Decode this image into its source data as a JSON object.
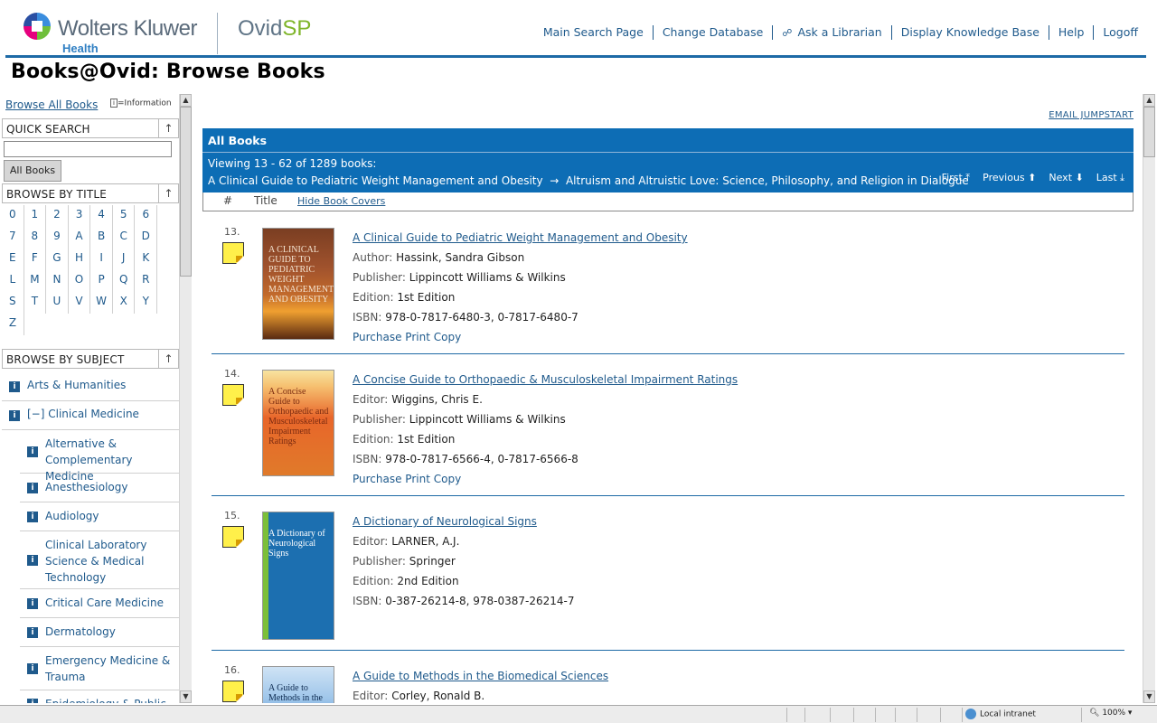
{
  "header": {
    "brand": "Wolters Kluwer",
    "brand_sub": "Health",
    "product_main": "Ovid",
    "product_accent": "SP",
    "nav": [
      "Main Search Page",
      "Change Database",
      "Ask a Librarian",
      "Display Knowledge Base",
      "Help",
      "Logoff"
    ]
  },
  "page_title": "Books@Ovid: Browse Books",
  "sidebar": {
    "browse_all": "Browse All Books",
    "info_legend": "=Information",
    "quick_search_label": "QUICK SEARCH",
    "quick_search_value": "",
    "all_books_button": "All Books",
    "browse_by_title_label": "BROWSE BY TITLE",
    "title_grid": [
      [
        "0",
        "1",
        "2",
        "3",
        "4",
        "5",
        "6"
      ],
      [
        "7",
        "8",
        "9",
        "A",
        "B",
        "C",
        "D"
      ],
      [
        "E",
        "F",
        "G",
        "H",
        "I",
        "J",
        "K"
      ],
      [
        "L",
        "M",
        "N",
        "O",
        "P",
        "Q",
        "R"
      ],
      [
        "S",
        "T",
        "U",
        "V",
        "W",
        "X",
        "Y"
      ],
      [
        "Z"
      ]
    ],
    "browse_by_subject_label": "BROWSE BY SUBJECT",
    "subjects": [
      {
        "label": "Arts & Humanities",
        "level": 1
      },
      {
        "label": "[−]  Clinical Medicine",
        "level": 1
      },
      {
        "label": "Alternative & Complementary Medicine",
        "level": 2
      },
      {
        "label": "Anesthesiology",
        "level": 2
      },
      {
        "label": "Audiology",
        "level": 2
      },
      {
        "label": "Clinical Laboratory Science & Medical Technology",
        "level": 2
      },
      {
        "label": "Critical Care Medicine",
        "level": 2
      },
      {
        "label": "Dermatology",
        "level": 2
      },
      {
        "label": "Emergency Medicine & Trauma",
        "level": 2
      },
      {
        "label": "Epidemiology & Public",
        "level": 2
      }
    ]
  },
  "main": {
    "email_jumpstart": "EMAIL JUMPSTART",
    "results_title": "All Books",
    "viewing": "Viewing 13 - 62 of 1289 books:",
    "range_from": "A Clinical Guide to Pediatric Weight Management and Obesity",
    "range_arrow": "→",
    "range_to": "Altruism and Altruistic Love: Science, Philosophy, and Religion in Dialogue",
    "pager": {
      "first": "First ⤒",
      "previous": "Previous ⬆",
      "next": "Next ⬇",
      "last": "Last ⤓"
    },
    "columns": {
      "num": "#",
      "title": "Title",
      "hide_covers": "Hide Book Covers"
    },
    "books": [
      {
        "num": "13.",
        "title": "A Clinical Guide to Pediatric Weight Management and Obesity",
        "role": "Author:",
        "person": "Hassink, Sandra Gibson",
        "publisher_label": "Publisher:",
        "publisher": "Lippincott Williams & Wilkins",
        "edition_label": "Edition:",
        "edition": "1st Edition",
        "isbn_label": "ISBN:",
        "isbn": "978-0-7817-6480-3, 0-7817-6480-7",
        "purchase": "Purchase Print Copy",
        "cover_text": "A CLINICAL GUIDE TO PEDIATRIC WEIGHT MANAGEMENT AND OBESITY"
      },
      {
        "num": "14.",
        "title": "A Concise Guide to Orthopaedic & Musculoskeletal Impairment Ratings",
        "role": "Editor:",
        "person": "Wiggins, Chris E.",
        "publisher_label": "Publisher:",
        "publisher": "Lippincott Williams & Wilkins",
        "edition_label": "Edition:",
        "edition": "1st Edition",
        "isbn_label": "ISBN:",
        "isbn": "978-0-7817-6566-4, 0-7817-6566-8",
        "purchase": "Purchase Print Copy",
        "cover_text": "A Concise Guide to Orthopaedic and Musculoskeletal Impairment Ratings"
      },
      {
        "num": "15.",
        "title": "A Dictionary of Neurological Signs",
        "role": "Editor:",
        "person": "LARNER, A.J.",
        "publisher_label": "Publisher:",
        "publisher": "Springer",
        "edition_label": "Edition:",
        "edition": "2nd Edition",
        "isbn_label": "ISBN:",
        "isbn": "0-387-26214-8, 978-0387-26214-7",
        "purchase": "",
        "cover_text": "A Dictionary of Neurological Signs"
      },
      {
        "num": "16.",
        "title": "A Guide to Methods in the Biomedical Sciences",
        "role": "Editor:",
        "person": "Corley, Ronald B.",
        "cover_text": "A Guide to Methods in the Biomedical Sciences"
      }
    ]
  },
  "statusbar": {
    "zone": "Local intranet",
    "zoom": "100%"
  }
}
